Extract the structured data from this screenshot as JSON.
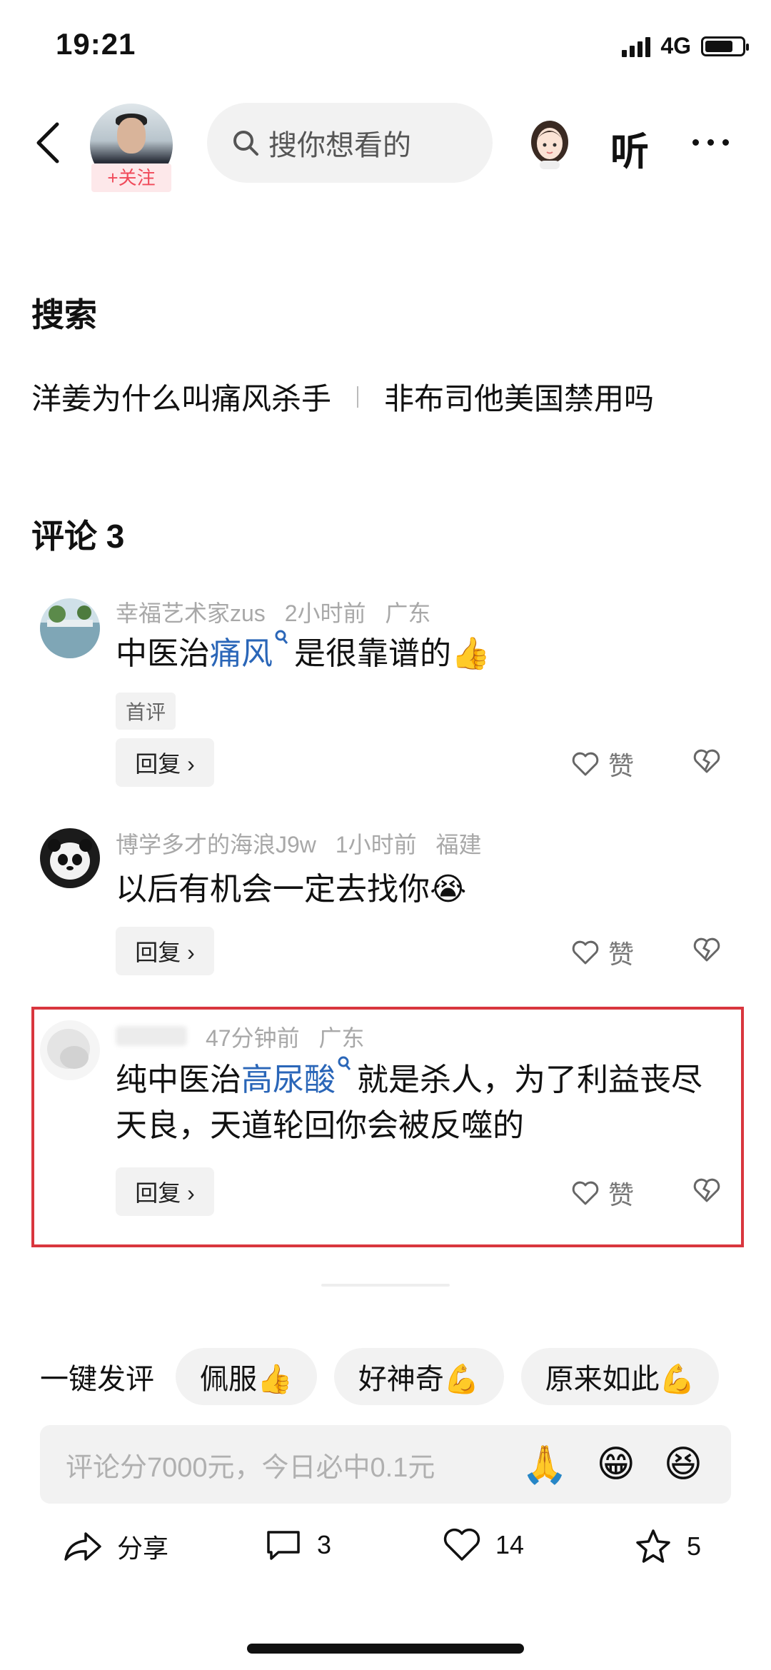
{
  "status_bar": {
    "time": "19:21",
    "network": "4G",
    "battery_level": 0.75
  },
  "header": {
    "follow_label": "+关注",
    "search_placeholder": "搜你想看的",
    "listen_label": "听",
    "icons": {
      "back": "chevron-left-icon",
      "search": "search-icon",
      "more": "more-dots-icon"
    }
  },
  "search_section": {
    "title": "搜索",
    "links": [
      "洋姜为什么叫痛风杀手",
      "非布司他美国禁用吗"
    ]
  },
  "comments_section": {
    "title": "评论 3",
    "comments": [
      {
        "author": "幸福艺术家zus",
        "time": "2小时前",
        "location": "广东",
        "text_before": "中医治",
        "keyword": "痛风",
        "text_after": "是很靠谱的👍",
        "tag": "首评",
        "reply_label": "回复 ›",
        "like_label": "赞"
      },
      {
        "author": "博学多才的海浪J9w",
        "time": "1小时前",
        "location": "福建",
        "text": "以后有机会一定去找你😭",
        "reply_label": "回复 ›",
        "like_label": "赞"
      },
      {
        "author": "",
        "time": "47分钟前",
        "location": "广东",
        "text_before": "纯中医治",
        "keyword": "高尿酸",
        "text_after": "就是杀人，为了利益丧尽天良，天道轮回你会被反噬的",
        "reply_label": "回复 ›",
        "like_label": "赞"
      }
    ]
  },
  "quick_comments": {
    "label": "一键发评",
    "chips": [
      "佩服👍",
      "好神奇💪",
      "原来如此💪"
    ]
  },
  "comment_input": {
    "placeholder": "评论分7000元，今日必中0.1元",
    "emojis": [
      "🙏",
      "😁",
      "😆"
    ]
  },
  "bottom_bar": {
    "share_label": "分享",
    "comment_count": "3",
    "like_count": "14",
    "favorite_count": "5"
  }
}
